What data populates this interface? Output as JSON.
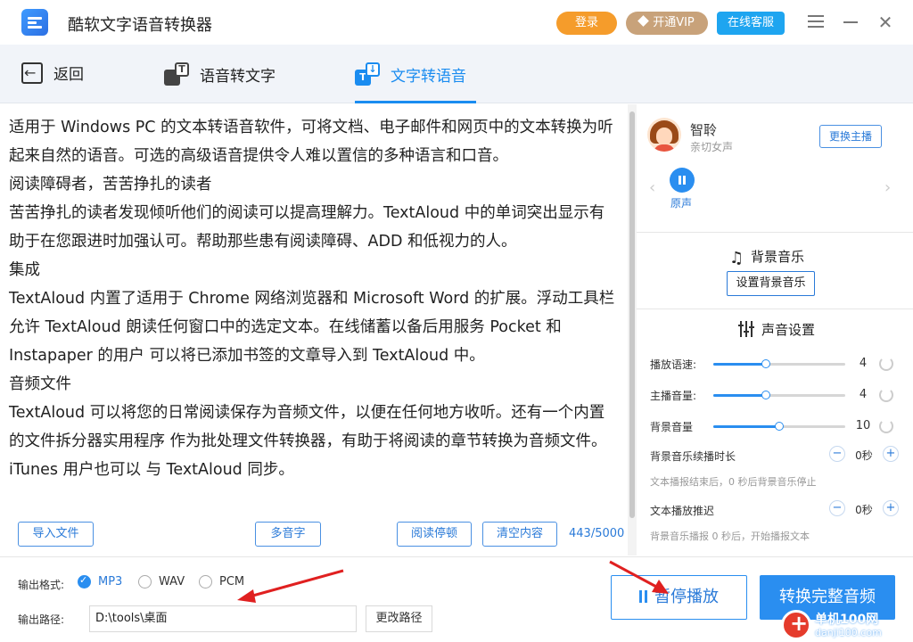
{
  "app": {
    "title": "酷软文字语音转换器",
    "login_label": "登录",
    "vip_label": "开通VIP",
    "service_label": "在线客服"
  },
  "nav": {
    "back_label": "返回",
    "speech_to_text_label": "语音转文字",
    "text_to_speech_label": "文字转语音",
    "active_tab": "文字转语音"
  },
  "editor": {
    "paragraphs": [
      "适用于 Windows PC 的文本转语音软件，可将文档、电子邮件和网页中的文本转换为听起来自然的语音。可选的高级语音提供令人难以置信的多种语言和口音。",
      "阅读障碍者，苦苦挣扎的读者",
      "苦苦挣扎的读者发现倾听他们的阅读可以提高理解力。TextAloud 中的单词突出显示有助于在您跟进时加强认可。帮助那些患有阅读障碍、ADD 和低视力的人。",
      "集成",
      "TextAloud 内置了适用于 Chrome 网络浏览器和 Microsoft Word 的扩展。浮动工具栏 允许 TextAloud 朗读任何窗口中的选定文本。在线储蓄以备后用服务 Pocket 和 Instapaper 的用户 可以将已添加书签的文章导入到 TextAloud 中。",
      "音频文件",
      "TextAloud 可以将您的日常阅读保存为音频文件，以便在任何地方收听。还有一个内置的文件拆分器实用程序 作为批处理文件转换器，有助于将阅读的章节转换为音频文件。iTunes 用户也可以 与 TextAloud 同步。"
    ],
    "import_label": "导入文件",
    "polyphone_label": "多音字",
    "read_pause_label": "阅读停顿",
    "clear_label": "清空内容",
    "char_count": "443/5000"
  },
  "voice": {
    "name": "智聆",
    "description": "亲切女声",
    "change_label": "更换主播",
    "sample_label": "原声",
    "state": "playing"
  },
  "bgm": {
    "title": "背景音乐",
    "set_label": "设置背景音乐"
  },
  "sound": {
    "title": "声音设置",
    "sliders": [
      {
        "label": "播放语速:",
        "value": 4,
        "fraction": 0.4
      },
      {
        "label": "主播音量:",
        "value": 4,
        "fraction": 0.4
      },
      {
        "label": "背景音量",
        "value": 10,
        "fraction": 0.5
      }
    ],
    "bgm_duration": {
      "label": "背景音乐续播时长",
      "value": "0秒",
      "hint": "文本播报结束后，0 秒后背景音乐停止"
    },
    "text_delay": {
      "label": "文本播放推迟",
      "value": "0秒",
      "hint": "背景音乐播报 0 秒后，开始播报文本"
    }
  },
  "output": {
    "format_label": "输出格式:",
    "formats": [
      "MP3",
      "WAV",
      "PCM"
    ],
    "selected_format": "MP3",
    "path_label": "输出路径:",
    "path_value": "D:\\tools\\桌面",
    "change_path_label": "更改路径"
  },
  "actions": {
    "pause_label": "暂停播放",
    "convert_label": "转换完整音频"
  },
  "watermark": {
    "site": "单机100网",
    "url": "danji100.com"
  },
  "colors": {
    "accent": "#2a8ef0",
    "login": "#f59c2b",
    "vip": "#c8a27a",
    "service": "#1ea5f0",
    "annotation_arrow": "#e02020"
  }
}
